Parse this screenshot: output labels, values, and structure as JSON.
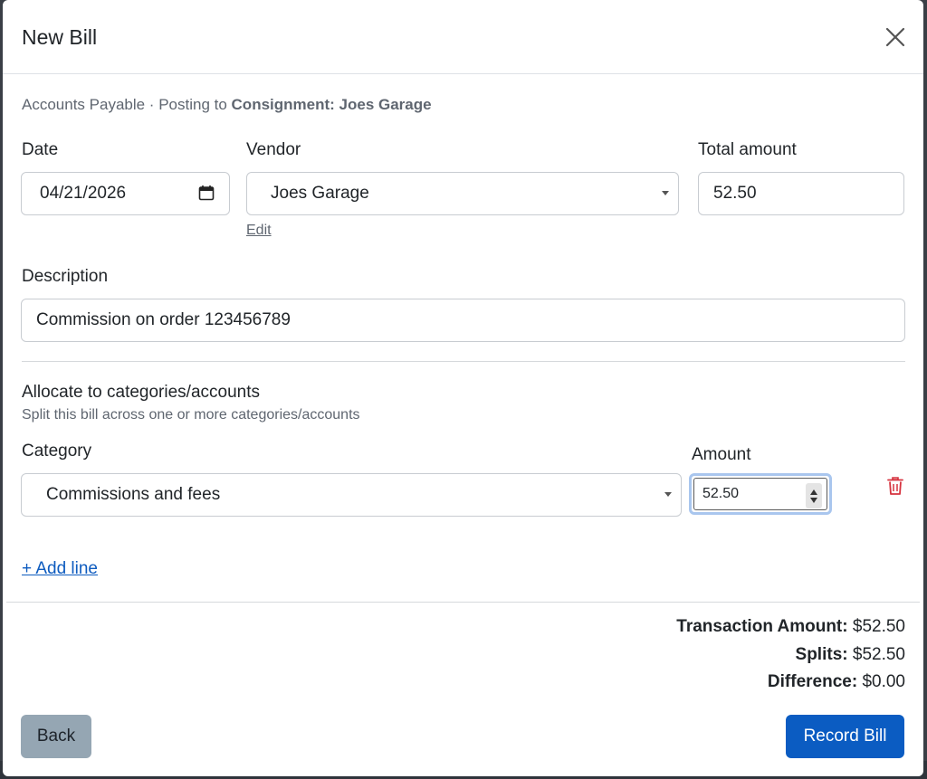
{
  "modal": {
    "title": "New Bill",
    "subline_prefix": "Accounts Payable · Posting to",
    "subline_target": "Consignment: Joes Garage"
  },
  "form": {
    "date_label": "Date",
    "date_value": "04/21/2026",
    "vendor_label": "Vendor",
    "vendor_value": "Joes Garage",
    "edit_label": "Edit",
    "total_label": "Total amount",
    "total_value": "52.50",
    "description_label": "Description",
    "description_value": "Commission on order 123456789"
  },
  "allocation": {
    "title": "Allocate to categories/accounts",
    "subtitle": "Split this bill across one or more categories/accounts",
    "category_label": "Category",
    "amount_label": "Amount",
    "lines": [
      {
        "category": "Commissions and fees",
        "amount": "52.50"
      }
    ],
    "add_line_label": "+ Add line"
  },
  "summary": {
    "transaction_label": "Transaction Amount:",
    "transaction_value": "$52.50",
    "splits_label": "Splits:",
    "splits_value": "$52.50",
    "difference_label": "Difference:",
    "difference_value": "$0.00"
  },
  "buttons": {
    "back": "Back",
    "record": "Record Bill"
  },
  "colors": {
    "primary": "#0b5cc2",
    "secondary": "#95a6b3",
    "danger": "#d6333f",
    "link": "#0d5bbf"
  },
  "icons": {
    "close": "close-icon",
    "calendar": "calendar-icon",
    "trash": "trash-icon"
  }
}
